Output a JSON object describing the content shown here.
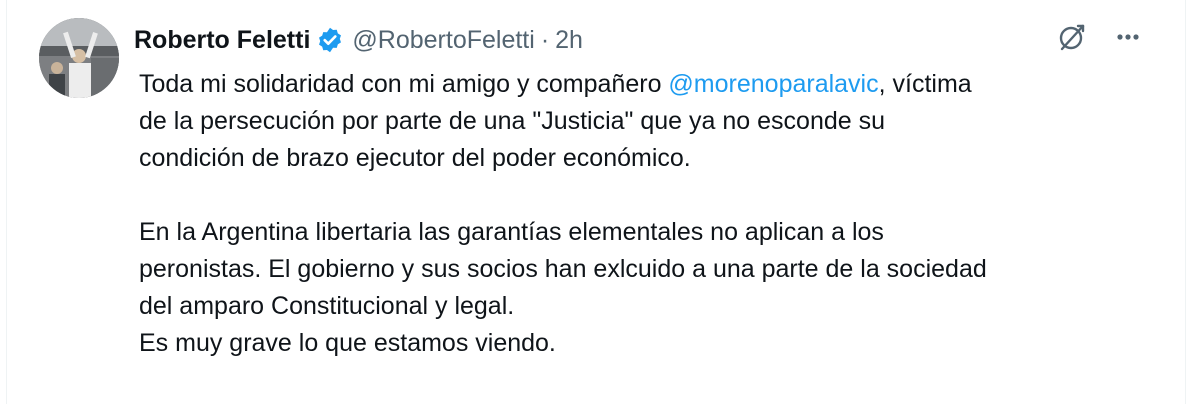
{
  "author": {
    "name": "Roberto Feletti",
    "handle": "@RobertoFeletti",
    "separator": "·",
    "time": "2h"
  },
  "icons": {
    "verified": "verified-badge-icon",
    "grok": "grok-icon",
    "more": "more-icon",
    "accent": "#1d9bf0"
  },
  "tweet": {
    "p1_line1_pre": "Toda mi solidaridad con mi amigo y compañero ",
    "p1_mention": "@morenoparalavic",
    "p1_line1_post": ", víctima",
    "p1_line2": "de la persecución por parte de una \"Justicia\" que ya no esconde su",
    "p1_line3": "condición de brazo ejecutor del poder económico.",
    "p2_line1": "En la Argentina libertaria las garantías elementales no aplican a los",
    "p2_line2": "peronistas. El gobierno y sus socios han exlcuido a una parte de la sociedad",
    "p2_line3": "del amparo Constitucional y legal.",
    "p2_line4": "Es muy grave lo que estamos viendo."
  }
}
